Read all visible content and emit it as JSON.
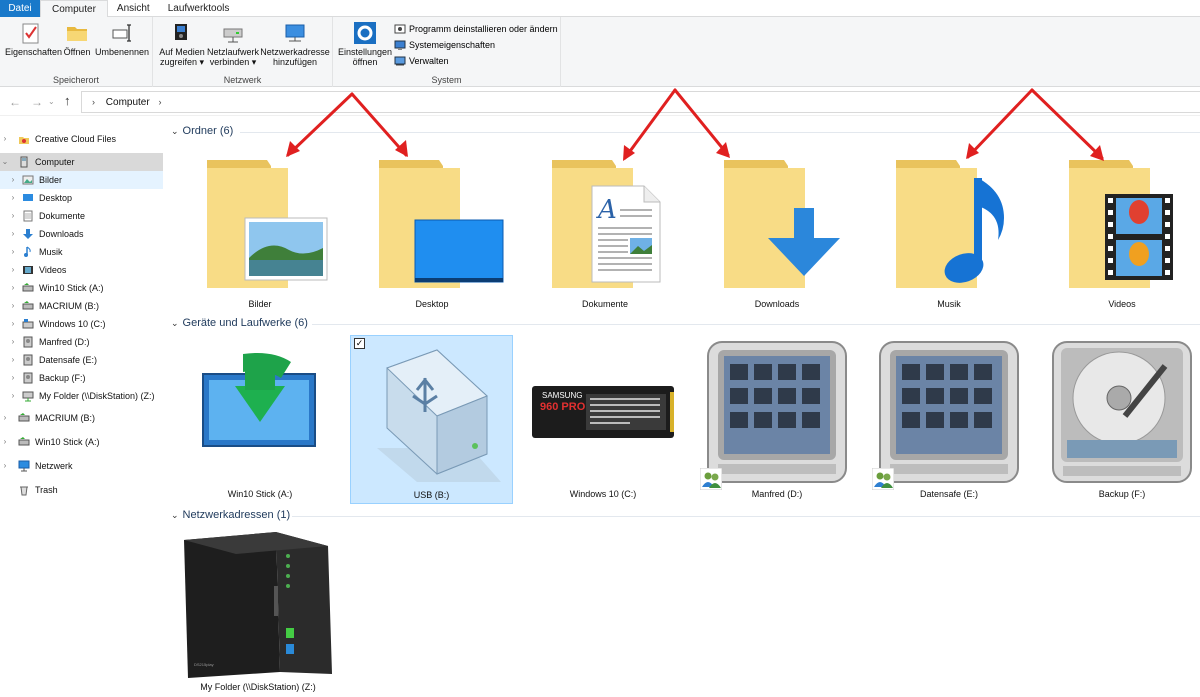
{
  "ribbon": {
    "tabs": [
      "Datei",
      "Computer",
      "Ansicht",
      "Laufwerktools"
    ],
    "groups": {
      "speicherort": {
        "label": "Speicherort",
        "buttons": [
          "Eigenschaften",
          "Öffnen",
          "Umbenennen"
        ]
      },
      "netzwerk": {
        "label": "Netzwerk",
        "buttons": [
          {
            "line1": "Auf Medien",
            "line2": "zugreifen ▾"
          },
          {
            "line1": "Netzlaufwerk",
            "line2": "verbinden ▾"
          },
          {
            "line1": "Netzwerkadresse",
            "line2": "hinzufügen"
          }
        ]
      },
      "system": {
        "label": "System",
        "big_button": {
          "line1": "Einstellungen",
          "line2": "öffnen"
        },
        "small_buttons": [
          "Programm deinstallieren oder ändern",
          "Systemeigenschaften",
          "Verwalten"
        ]
      }
    }
  },
  "address": {
    "path": "Computer"
  },
  "sidebar": {
    "items": [
      {
        "label": "Creative Cloud Files",
        "icon": "creative-cloud-icon"
      },
      {
        "label": "Computer",
        "icon": "computer-icon",
        "expanded": true
      },
      {
        "label": "Bilder",
        "icon": "pictures-folder-icon"
      },
      {
        "label": "Desktop",
        "icon": "desktop-folder-icon"
      },
      {
        "label": "Dokumente",
        "icon": "documents-folder-icon"
      },
      {
        "label": "Downloads",
        "icon": "downloads-folder-icon"
      },
      {
        "label": "Musik",
        "icon": "music-folder-icon"
      },
      {
        "label": "Videos",
        "icon": "videos-folder-icon"
      },
      {
        "label": "Win10 Stick (A:)",
        "icon": "usb-drive-icon"
      },
      {
        "label": "MACRIUM (B:)",
        "icon": "usb-drive-icon"
      },
      {
        "label": "Windows 10 (C:)",
        "icon": "system-drive-icon"
      },
      {
        "label": "Manfred (D:)",
        "icon": "drive-icon"
      },
      {
        "label": "Datensafe (E:)",
        "icon": "drive-icon"
      },
      {
        "label": "Backup (F:)",
        "icon": "drive-icon"
      },
      {
        "label": "My Folder (\\\\DiskStation) (Z:)",
        "icon": "network-drive-icon"
      },
      {
        "label": "MACRIUM (B:)",
        "icon": "usb-drive-icon"
      },
      {
        "label": "Win10 Stick (A:)",
        "icon": "usb-drive-icon"
      },
      {
        "label": "Netzwerk",
        "icon": "network-icon"
      },
      {
        "label": "Trash",
        "icon": "trash-icon"
      }
    ]
  },
  "sections": {
    "ordner": {
      "title": "Ordner (6)",
      "items": [
        "Bilder",
        "Desktop",
        "Dokumente",
        "Downloads",
        "Musik",
        "Videos"
      ]
    },
    "geraete": {
      "title": "Geräte und Laufwerke (6)",
      "items": [
        "Win10 Stick (A:)",
        "USB (B:)",
        "Windows 10 (C:)",
        "Manfred (D:)",
        "Datensafe (E:)",
        "Backup (F:)"
      ]
    },
    "netzwerkadressen": {
      "title": "Netzwerkadressen (1)",
      "items": [
        "My Folder (\\\\DiskStation) (Z:)"
      ]
    }
  },
  "ssd_label": {
    "line1": "960 PRO",
    "brand": "SAMSUNG"
  },
  "nas_label": "DS215play",
  "colors": {
    "accent": "#1979ca",
    "folder": "#f7d774",
    "annotation_arrow": "#e02020",
    "selection": "#cce8ff"
  }
}
